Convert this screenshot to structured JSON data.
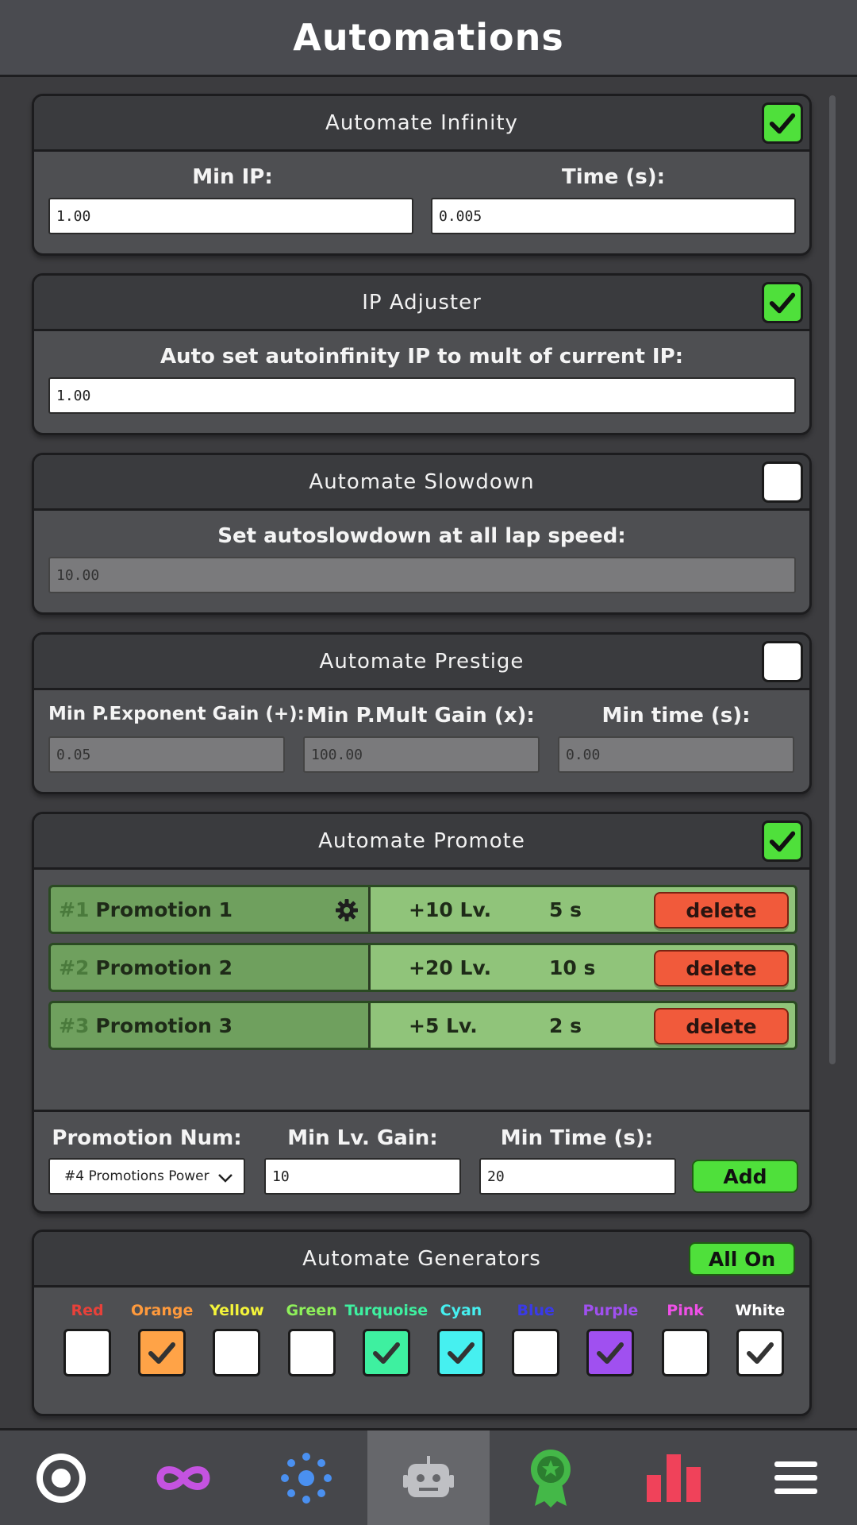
{
  "header": {
    "title": "Automations"
  },
  "infinity": {
    "title": "Automate Infinity",
    "enabled": true,
    "min_ip_label": "Min IP:",
    "min_ip_value": "1.00",
    "time_label": "Time (s):",
    "time_value": "0.005"
  },
  "ip_adjuster": {
    "title": "IP Adjuster",
    "enabled": true,
    "label": "Auto set autoinfinity IP to mult of current IP:",
    "value": "1.00"
  },
  "slowdown": {
    "title": "Automate Slowdown",
    "enabled": false,
    "label": "Set autoslowdown at all lap speed:",
    "value": "10.00"
  },
  "prestige": {
    "title": "Automate Prestige",
    "enabled": false,
    "exp_label": "Min P.Exponent Gain (+):",
    "exp_value": "0.05",
    "mult_label": "Min P.Mult Gain (x):",
    "mult_value": "100.00",
    "time_label": "Min time (s):",
    "time_value": "0.00"
  },
  "promote": {
    "title": "Automate Promote",
    "enabled": true,
    "rows": [
      {
        "num": "#1",
        "name": "Promotion 1",
        "lv": "+10 Lv.",
        "time": "5 s",
        "delete": "delete"
      },
      {
        "num": "#2",
        "name": "Promotion 2",
        "lv": "+20 Lv.",
        "time": "10 s",
        "delete": "delete"
      },
      {
        "num": "#3",
        "name": "Promotion 3",
        "lv": "+5 Lv.",
        "time": "2 s",
        "delete": "delete"
      }
    ],
    "num_label": "Promotion Num:",
    "num_selected": "#4 Promotions Power",
    "lv_label": "Min Lv. Gain:",
    "lv_value": "10",
    "time_label": "Min Time (s):",
    "time_value": "20",
    "add_label": "Add"
  },
  "generators": {
    "title": "Automate Generators",
    "all_on_label": "All On",
    "items": [
      {
        "name": "Red",
        "color": "#e8413a",
        "checked": false,
        "fill": "#ffffff"
      },
      {
        "name": "Orange",
        "color": "#ff9a3c",
        "checked": true,
        "fill": "#ffa347"
      },
      {
        "name": "Yellow",
        "color": "#f4f43a",
        "checked": false,
        "fill": "#ffffff"
      },
      {
        "name": "Green",
        "color": "#8ef05a",
        "checked": false,
        "fill": "#ffffff"
      },
      {
        "name": "Turquoise",
        "color": "#3ef0a0",
        "checked": true,
        "fill": "#3ef0a0"
      },
      {
        "name": "Cyan",
        "color": "#46f0f0",
        "checked": true,
        "fill": "#46f0f0"
      },
      {
        "name": "Blue",
        "color": "#3a3ae8",
        "checked": false,
        "fill": "#ffffff"
      },
      {
        "name": "Purple",
        "color": "#a050f0",
        "checked": true,
        "fill": "#a050f0"
      },
      {
        "name": "Pink",
        "color": "#f050e8",
        "checked": false,
        "fill": "#ffffff"
      },
      {
        "name": "White",
        "color": "#ffffff",
        "checked": true,
        "fill": "#ffffff"
      }
    ]
  },
  "nav": {
    "items": [
      "target-icon",
      "infinity-icon",
      "dots-icon",
      "robot-icon",
      "award-icon",
      "bar-chart-icon",
      "menu-icon"
    ],
    "active": "robot-icon"
  }
}
